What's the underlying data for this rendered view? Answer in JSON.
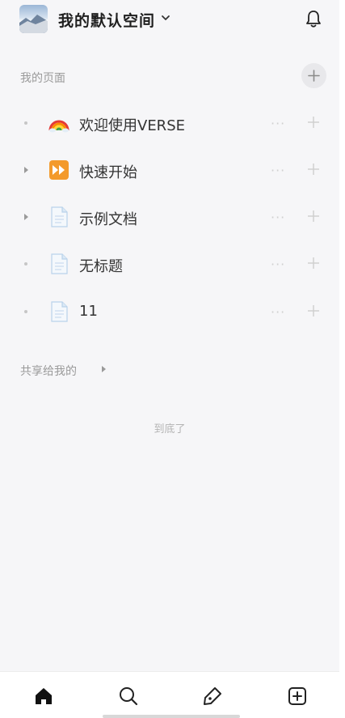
{
  "header": {
    "workspace_name": "我的默认空间"
  },
  "sections": {
    "my_pages": "我的页面",
    "shared_with_me": "共享给我的"
  },
  "pages": [
    {
      "label": "欢迎使用VERSE",
      "icon": "rainbow-icon",
      "expandable": false
    },
    {
      "label": "快速开始",
      "icon": "fast-forward-icon",
      "expandable": true
    },
    {
      "label": "示例文档",
      "icon": "document-icon",
      "expandable": true
    },
    {
      "label": "无标题",
      "icon": "document-icon",
      "expandable": false
    },
    {
      "label": "11",
      "icon": "document-icon",
      "expandable": false
    }
  ],
  "row_more_glyph": "···",
  "bottom_text": "到底了",
  "tabbar": {
    "tabs": [
      {
        "name": "home",
        "active": true
      },
      {
        "name": "search",
        "active": false
      },
      {
        "name": "edit",
        "active": false
      },
      {
        "name": "new",
        "active": false
      }
    ]
  },
  "colors": {
    "background": "#f6f6f8",
    "fast_forward": "#f39a2b",
    "document": "#cfe3f6"
  }
}
